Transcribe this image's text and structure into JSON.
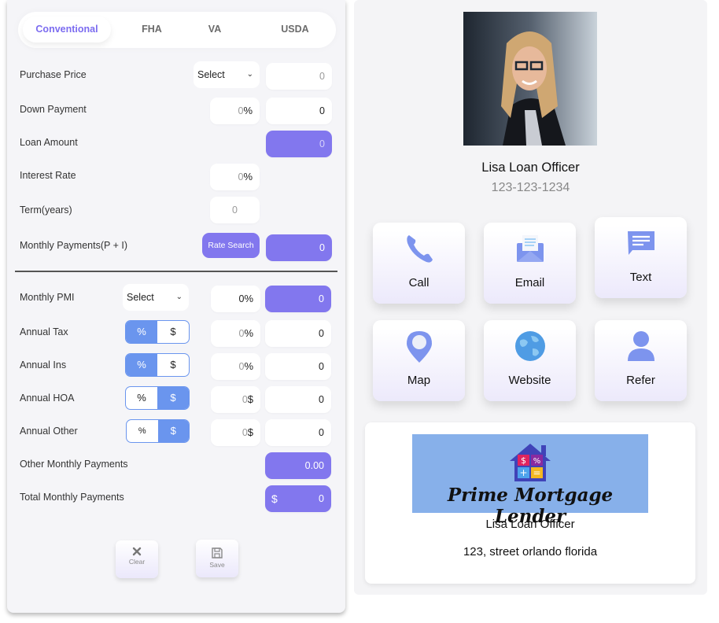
{
  "calculator": {
    "tabs": [
      {
        "label": "Conventional",
        "active": true
      },
      {
        "label": "FHA",
        "active": false
      },
      {
        "label": "VA",
        "active": false
      },
      {
        "label": "USDA",
        "active": false
      }
    ],
    "rows": {
      "purchase_price": {
        "label": "Purchase Price",
        "select": "Select",
        "value": "0"
      },
      "down_payment": {
        "label": "Down Payment",
        "percent": "0",
        "percent_suffix": "%",
        "value": "0"
      },
      "loan_amount": {
        "label": "Loan Amount",
        "value": "0"
      },
      "interest_rate": {
        "label": "Interest Rate",
        "percent": "0",
        "percent_suffix": "%"
      },
      "term": {
        "label": "Term(years)",
        "value": "0"
      },
      "monthly_payments": {
        "label": "Monthly Payments(P + I)",
        "button": "Rate Search",
        "value": "0"
      },
      "monthly_pmi": {
        "label": "Monthly PMI",
        "select": "Select",
        "percent": "0",
        "percent_suffix": "%",
        "value": "0"
      },
      "annual_tax": {
        "label": "Annual Tax",
        "toggle": [
          "%",
          "$"
        ],
        "toggle_active": "%",
        "input": "0",
        "suffix": "%",
        "value": "0"
      },
      "annual_ins": {
        "label": "Annual Ins",
        "toggle": [
          "%",
          "$"
        ],
        "toggle_active": "%",
        "input": "0",
        "suffix": "%",
        "value": "0"
      },
      "annual_hoa": {
        "label": "Annual HOA",
        "toggle": [
          "%",
          "$"
        ],
        "toggle_active": "$",
        "input": "0",
        "suffix": "$",
        "value": "0"
      },
      "annual_other": {
        "label": "Annual Other",
        "toggle": [
          "%",
          "$"
        ],
        "toggle_active": "$",
        "input": "0",
        "suffix": "$",
        "value": "0"
      },
      "other_monthly": {
        "label": "Other Monthly Payments",
        "value": "0.00"
      },
      "total_monthly": {
        "label": "Total Monthly Payments",
        "prefix": "$",
        "value": "0"
      }
    },
    "actions": {
      "clear": "Clear",
      "save": "Save"
    }
  },
  "profile": {
    "photo_alt": "Loan officer photo",
    "name": "Lisa Loan Officer",
    "phone": "123-123-1234",
    "contacts": [
      {
        "label": "Call",
        "icon": "phone-icon"
      },
      {
        "label": "Email",
        "icon": "envelope-icon"
      },
      {
        "label": "Text",
        "icon": "chat-icon"
      },
      {
        "label": "Map",
        "icon": "map-pin-icon"
      },
      {
        "label": "Website",
        "icon": "globe-icon"
      },
      {
        "label": "Refer",
        "icon": "person-icon"
      }
    ],
    "card": {
      "logo_text": "Prime Mortgage Lender",
      "name": "Lisa Loan Officer",
      "address": "123, street orlando florida"
    }
  },
  "colors": {
    "accent": "#8277ee",
    "toggle": "#6a95ee",
    "tab_active": "#7c6cf0"
  }
}
